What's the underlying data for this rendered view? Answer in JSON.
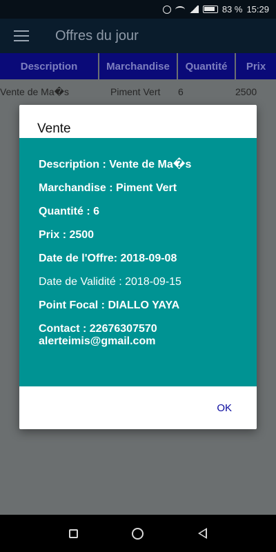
{
  "status_bar": {
    "battery": "83 %",
    "time": "15:29"
  },
  "app_bar": {
    "title": "Offres du jour"
  },
  "table": {
    "headers": [
      "Description",
      "Marchandise",
      "Quantité",
      "Prix"
    ],
    "rows": [
      [
        "Vente de Ma�s",
        "Piment Vert",
        "6",
        "2500"
      ]
    ]
  },
  "dialog": {
    "title": "Vente",
    "fields": {
      "description": "Description  : Vente de Ma�s",
      "marchandise": "Marchandise : Piment Vert",
      "quantite": "Quantité : 6",
      "prix": "Prix : 2500",
      "date_offre": "Date de l'Offre: 2018-09-08",
      "date_validite": "Date de Validité  : 2018-09-15",
      "point_focal": "Point Focal   : DIALLO  YAYA",
      "contact": "Contact  : 22676307570",
      "email": "alerteimis@gmail.com"
    },
    "ok_label": "OK"
  },
  "colors": {
    "app_bar": "#0a1c2c",
    "table_header": "#0a0a78",
    "dialog_body": "#009393",
    "ok_text": "#0a0a9e"
  }
}
